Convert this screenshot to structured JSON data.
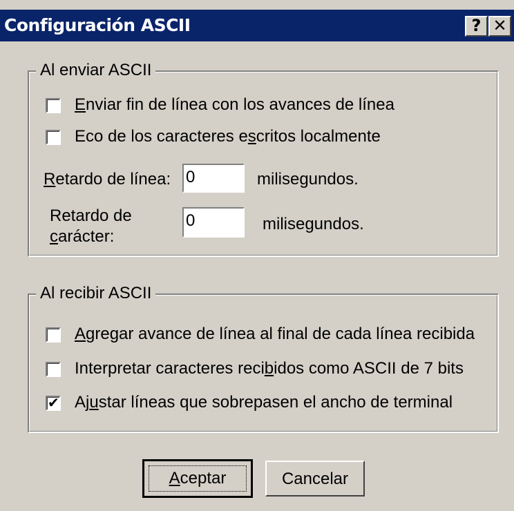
{
  "window": {
    "title": "Configuración ASCII",
    "help_glyph": "?",
    "close_glyph": "✕"
  },
  "send_group": {
    "legend": "Al enviar ASCII",
    "option1": {
      "pre": "",
      "acc": "E",
      "post": "nviar fin de línea con los avances de línea",
      "checked": false
    },
    "option2": {
      "pre": "Eco de los caracteres e",
      "acc": "s",
      "post": "critos localmente",
      "checked": false
    },
    "line_delay": {
      "pre": "",
      "acc": "R",
      "post": "etardo de línea:",
      "value": "0",
      "unit": "milisegundos."
    },
    "char_delay": {
      "line1": "Retardo de",
      "acc": "c",
      "post": "arácter:",
      "value": "0",
      "unit": "milisegundos."
    }
  },
  "receive_group": {
    "legend": "Al recibir ASCII",
    "option1": {
      "pre": "",
      "acc": "A",
      "post": "gregar avance de línea al final de cada línea recibida",
      "checked": false
    },
    "option2": {
      "pre": "Interpretar caracteres reci",
      "acc": "b",
      "post": "idos como ASCII de 7 bits",
      "checked": false
    },
    "option3": {
      "pre": "Aj",
      "acc": "u",
      "post": "star líneas que sobrepasen el ancho de terminal",
      "checked": true
    }
  },
  "buttons": {
    "ok": {
      "pre": "",
      "acc": "A",
      "post": "ceptar"
    },
    "cancel": "Cancelar"
  },
  "colors": {
    "titlebar": "#0a246a",
    "face": "#d4d0c8"
  }
}
